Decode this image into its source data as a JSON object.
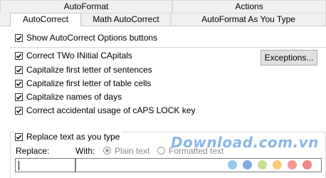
{
  "tabs_row1": [
    {
      "label": "AutoFormat"
    },
    {
      "label": "Actions"
    }
  ],
  "tabs_row2": [
    {
      "label": "AutoCorrect",
      "active": true
    },
    {
      "label": "Math AutoCorrect"
    },
    {
      "label": "AutoFormat As You Type"
    }
  ],
  "options": {
    "show_buttons": {
      "label": "Show AutoCorrect Options buttons",
      "checked": true
    },
    "items": [
      {
        "label": "Correct TWo INitial CApitals",
        "checked": true
      },
      {
        "label": "Capitalize first letter of sentences",
        "checked": true
      },
      {
        "label": "Capitalize first letter of table cells",
        "checked": true
      },
      {
        "label": "Capitalize names of days",
        "checked": true
      },
      {
        "label": "Correct accidental usage of cAPS LOCK key",
        "checked": true
      }
    ],
    "exceptions_button": "Exceptions..."
  },
  "replace": {
    "toggle": {
      "label": "Replace text as you type",
      "checked": true
    },
    "replace_label": "Replace:",
    "with_label": "With:",
    "plain_text": "Plain text",
    "formatted_text": "Formatted text",
    "plain_selected": true,
    "replace_value": "",
    "with_value": ""
  },
  "watermark": {
    "text": "Download.com.vn",
    "dot_colors": [
      "#4fa3e0",
      "#2e6fd8",
      "#9ccc3f",
      "#f5a623",
      "#ef5350",
      "#e53935"
    ]
  }
}
